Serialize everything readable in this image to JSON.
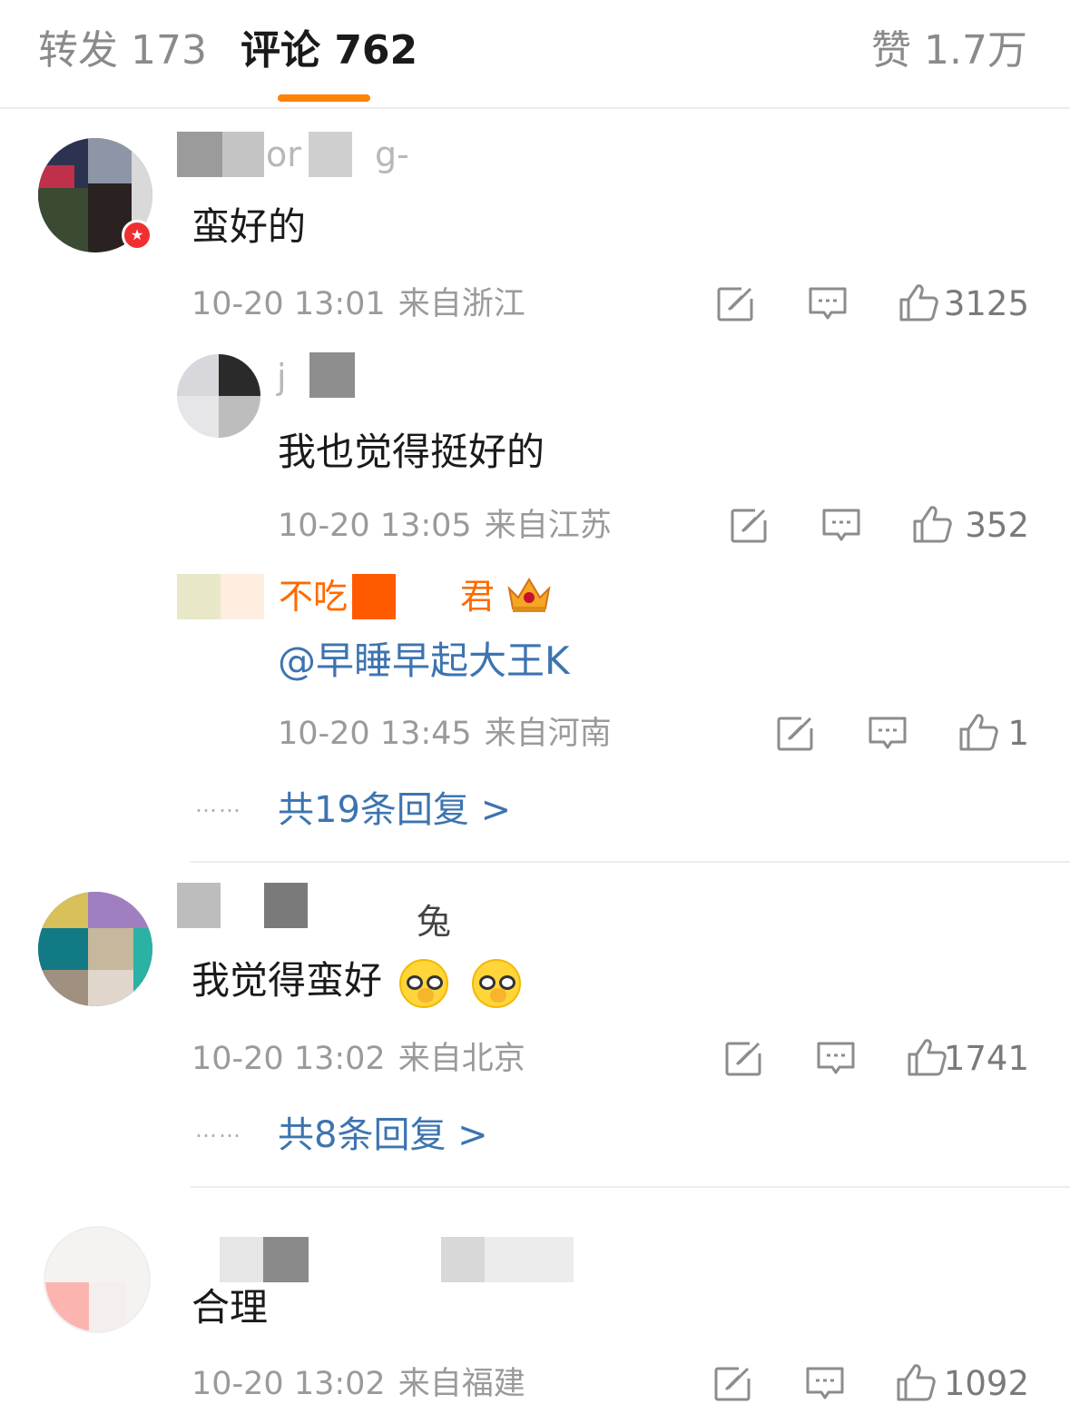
{
  "tabs": {
    "forward": "转发 173",
    "comments": "评论 762",
    "likes": "赞 1.7万"
  },
  "icons": {
    "share": "share-icon",
    "reply": "comment-icon",
    "like": "thumbs-up-icon"
  },
  "colors": {
    "accent": "#ff8200",
    "link": "#3d74b0",
    "meta": "#9a9a9a"
  },
  "comments": [
    {
      "name_fragments": [
        "or",
        "g-"
      ],
      "text": "蛮好的",
      "time": "10-20 13:01",
      "location": "来自浙江",
      "likes": "3125",
      "replies": [
        {
          "name_fragments": [
            "j"
          ],
          "text": "我也觉得挺好的",
          "time": "10-20 13:05",
          "location": "来自江苏",
          "likes": "352"
        },
        {
          "name_fragments": [
            "不吃",
            "君"
          ],
          "text": "@早睡早起大王K",
          "time": "10-20 13:45",
          "location": "来自河南",
          "likes": "1"
        }
      ],
      "reply_summary": "共19条回复 >"
    },
    {
      "name_fragments": [
        "兔"
      ],
      "text": "我觉得蛮好",
      "time": "10-20 13:02",
      "location": "来自北京",
      "likes": "1741",
      "reply_summary": "共8条回复 >"
    },
    {
      "name_fragments": [],
      "text": "合理",
      "time": "10-20 13:02",
      "location": "来自福建",
      "likes": "1092"
    }
  ],
  "dots": "……"
}
